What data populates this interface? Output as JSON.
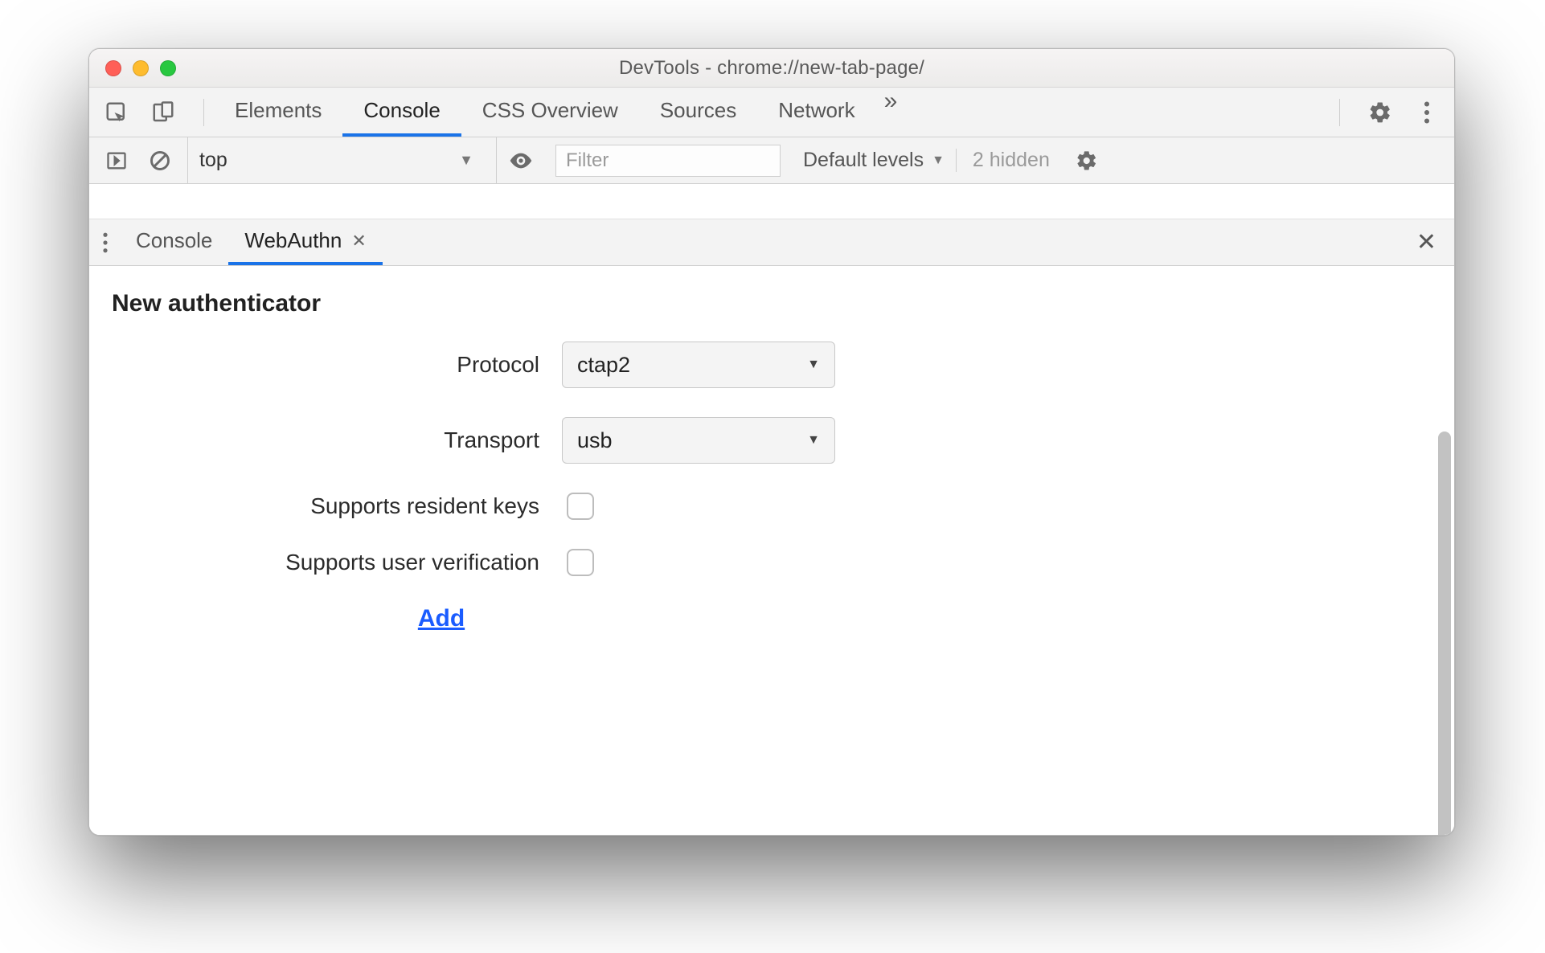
{
  "window": {
    "title": "DevTools - chrome://new-tab-page/"
  },
  "top_tabs": {
    "items": [
      "Elements",
      "Console",
      "CSS Overview",
      "Sources",
      "Network"
    ],
    "active_index": 1
  },
  "console_toolbar": {
    "context": "top",
    "filter_placeholder": "Filter",
    "levels_label": "Default levels",
    "hidden_label": "2 hidden"
  },
  "drawer": {
    "tabs": [
      "Console",
      "WebAuthn"
    ],
    "active_index": 1
  },
  "panel": {
    "heading": "New authenticator",
    "protocol_label": "Protocol",
    "protocol_value": "ctap2",
    "transport_label": "Transport",
    "transport_value": "usb",
    "resident_label": "Supports resident keys",
    "userverif_label": "Supports user verification",
    "add_label": "Add"
  }
}
